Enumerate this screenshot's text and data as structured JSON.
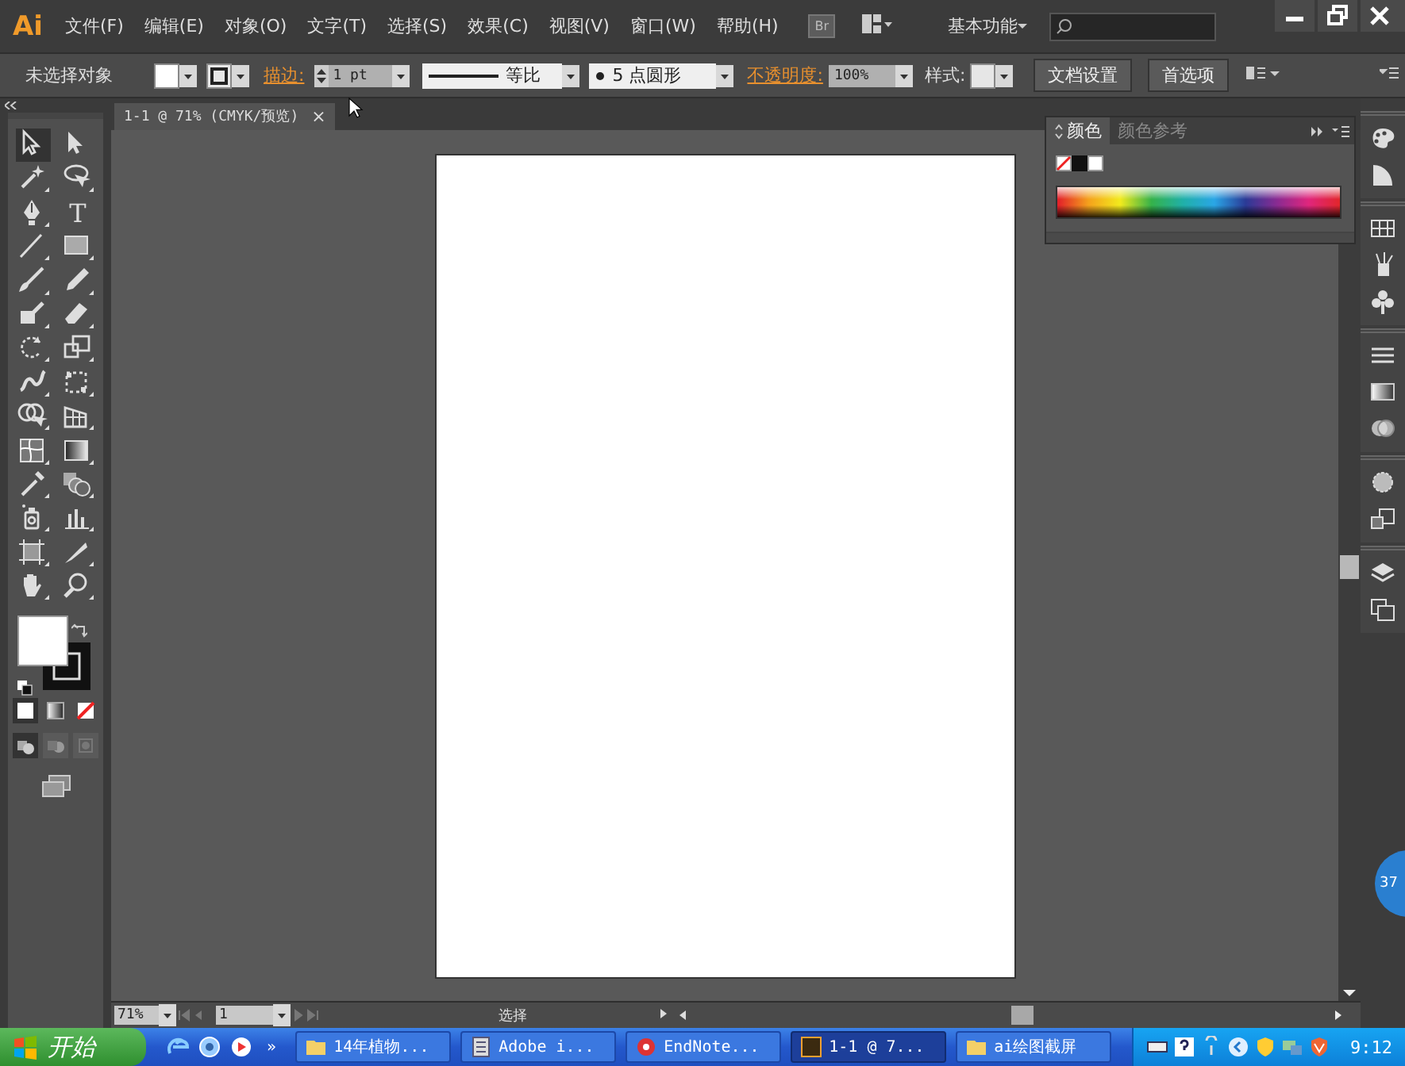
{
  "menu_bar": {
    "logo": "Ai",
    "menus": [
      "文件(F)",
      "编辑(E)",
      "对象(O)",
      "文字(T)",
      "选择(S)",
      "效果(C)",
      "视图(V)",
      "窗口(W)",
      "帮助(H)"
    ],
    "bridge_button": "Br",
    "workspace": "基本功能"
  },
  "control_bar": {
    "selection": "未选择对象",
    "stroke_label": "描边:",
    "stroke_weight": "1 pt",
    "stroke_profile": "等比",
    "brush": "5 点圆形",
    "opacity_label": "不透明度:",
    "opacity": "100%",
    "style_label": "样式:",
    "buttons": [
      "文档设置",
      "首选项"
    ]
  },
  "document_tab": {
    "title": "1-1 @ 71% (CMYK/预览)",
    "close": "×"
  },
  "tools": [
    {
      "kind": "select",
      "selected": true
    },
    {
      "kind": "direct",
      "selected": false
    },
    {
      "kind": "wand",
      "selected": false
    },
    {
      "kind": "lasso",
      "selected": false
    },
    {
      "kind": "pen",
      "selected": false
    },
    {
      "kind": "type",
      "label": "T",
      "selected": false
    },
    {
      "kind": "line",
      "selected": false
    },
    {
      "kind": "rect",
      "selected": false
    },
    {
      "kind": "brush",
      "selected": false
    },
    {
      "kind": "pencil",
      "selected": false
    },
    {
      "kind": "blob",
      "selected": false
    },
    {
      "kind": "eraser",
      "selected": false
    },
    {
      "kind": "rotate",
      "selected": false
    },
    {
      "kind": "scale",
      "selected": false
    },
    {
      "kind": "warp",
      "selected": false
    },
    {
      "kind": "transform",
      "selected": false
    },
    {
      "kind": "builder",
      "selected": false
    },
    {
      "kind": "perspective",
      "selected": false
    },
    {
      "kind": "mesh",
      "selected": false
    },
    {
      "kind": "gradient",
      "selected": false
    },
    {
      "kind": "eyedropper",
      "selected": false
    },
    {
      "kind": "blend",
      "selected": false
    },
    {
      "kind": "sprayer",
      "selected": false
    },
    {
      "kind": "graph",
      "selected": false
    },
    {
      "kind": "artboard",
      "selected": false
    },
    {
      "kind": "slice",
      "selected": false
    },
    {
      "kind": "hand",
      "selected": false
    },
    {
      "kind": "zoom",
      "selected": false
    }
  ],
  "color_modes": [
    {
      "kind": "color",
      "selected": true
    },
    {
      "kind": "gradient",
      "selected": false
    },
    {
      "kind": "none",
      "selected": false
    }
  ],
  "draw_modes": [
    {
      "kind": "normal",
      "selected": true
    },
    {
      "kind": "behind",
      "selected": false
    },
    {
      "kind": "inside",
      "selected": false
    }
  ],
  "color_panel": {
    "tabs": [
      {
        "label": "颜色",
        "selected": true
      },
      {
        "label": "颜色参考",
        "selected": false
      }
    ]
  },
  "status_bar": {
    "zoom": "71%",
    "artboard": "1",
    "tool_name": "选择"
  },
  "badge": "37",
  "taskbar": {
    "start": "开始",
    "more": "»",
    "tasks": [
      {
        "kind": "folder",
        "label": "14年植物...",
        "selected": false
      },
      {
        "kind": "document",
        "label": "Adobe i...",
        "selected": false
      },
      {
        "kind": "endnote",
        "label": "EndNote...",
        "selected": false
      },
      {
        "kind": "illustrator",
        "label": "1-1 @ 7...",
        "selected": true
      },
      {
        "kind": "folder",
        "label": "ai绘图截屏",
        "selected": false
      }
    ],
    "clock": "9:12"
  }
}
